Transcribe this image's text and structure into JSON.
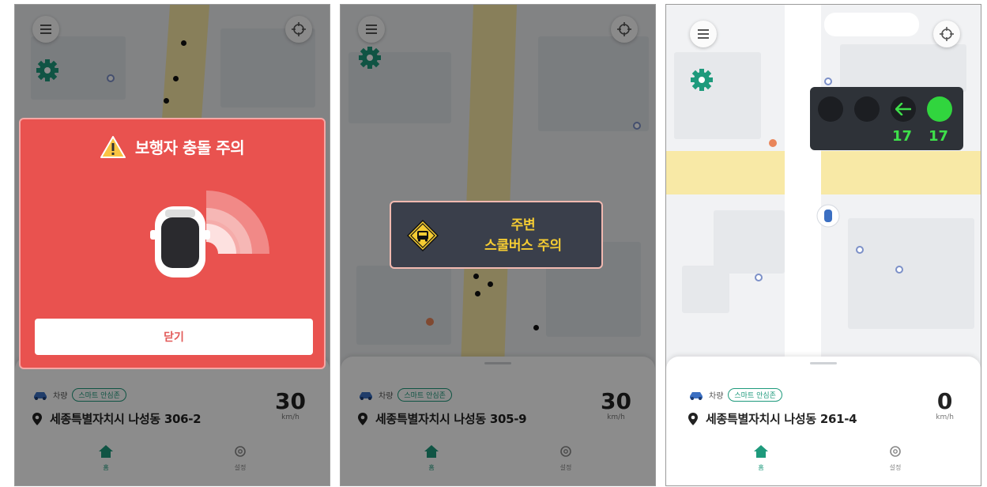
{
  "screens": [
    {
      "alert": {
        "title": "보행자 충돌 주의",
        "close_label": "닫기"
      },
      "vehicle": {
        "label": "차량",
        "mode": "스마트 안심존"
      },
      "address": "세종특별자치시 나성동 306-2",
      "speed": {
        "value": "30",
        "unit": "km/h"
      },
      "tabs": {
        "home": "홈",
        "settings": "설정"
      }
    },
    {
      "alert": {
        "line1": "주변",
        "line2": "스쿨버스 주의"
      },
      "vehicle": {
        "label": "차량",
        "mode": "스마트 안심존"
      },
      "address": "세종특별자치시 나성동 305-9",
      "speed": {
        "value": "30",
        "unit": "km/h"
      },
      "tabs": {
        "home": "홈",
        "settings": "설정"
      }
    },
    {
      "traffic_light": {
        "count_left": "17",
        "count_straight": "17"
      },
      "vehicle": {
        "label": "차량",
        "mode": "스마트 안심존"
      },
      "address": "세종특별자치시 나성동 261-4",
      "speed": {
        "value": "0",
        "unit": "km/h"
      },
      "tabs": {
        "home": "홈",
        "settings": "설정"
      }
    }
  ],
  "colors": {
    "accent": "#1e9a7c",
    "alert_red": "#e9524f",
    "alert_dark": "#3a3f4b",
    "bus_yellow": "#f5cc33",
    "signal_green": "#31d53e"
  },
  "icons": [
    "menu-icon",
    "target-icon",
    "gear-icon",
    "warning-icon",
    "car-icon",
    "school-bus-sign-icon",
    "arrow-left-icon",
    "location-pin-icon",
    "home-icon",
    "settings-icon"
  ]
}
